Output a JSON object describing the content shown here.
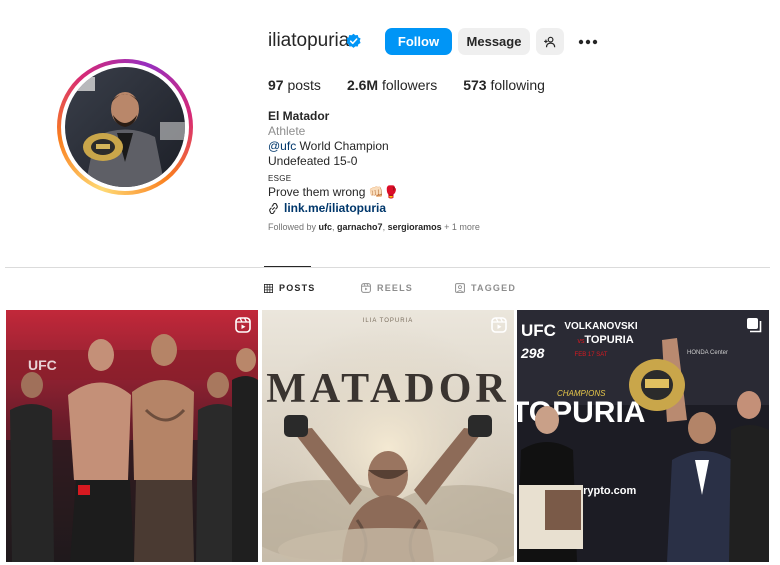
{
  "profile": {
    "username": "iliatopuria",
    "follow_label": "Follow",
    "message_label": "Message"
  },
  "stats": {
    "posts_count": "97",
    "posts_label": "posts",
    "followers_count": "2.6M",
    "followers_label": "followers",
    "following_count": "573",
    "following_label": "following"
  },
  "bio": {
    "name": "El Matador",
    "category": "Athlete",
    "mention": "@ufc",
    "line1_rest": " World Champion",
    "line2": "Undefeated 15-0",
    "small_caps": "ESGE",
    "line3": "Prove them wrong 👊🏻🥊",
    "link": "link.me/iliatopuria"
  },
  "followed_by": {
    "prefix": "Followed by ",
    "user1": "ufc",
    "sep1": ", ",
    "user2": "garnacho7",
    "sep2": ", ",
    "user3": "sergioramos",
    "suffix": " + 1 more"
  },
  "tabs": {
    "posts": "POSTS",
    "reels": "REELS",
    "tagged": "TAGGED"
  },
  "posts": {
    "p1_banner": "UFC",
    "p2_top": "ILIA TOPURIA",
    "p2_title": "MATADOR",
    "p3_banner_line1": "VOLKANOVSKI",
    "p3_banner_vs": "vs",
    "p3_banner_line2": "TOPURIA",
    "p3_date": "FEB 17 SAT",
    "p3_big": "TOPURIA",
    "p3_sub": "CHAMPIONS",
    "p3_ufc": "UFC",
    "p3_num": "298",
    "p3_crypto": "crypto.com",
    "p3_honda": "HONDA Center"
  },
  "colors": {
    "follow_blue": "#0095f6",
    "link_blue": "#00376b",
    "verified_blue": "#0095f6"
  }
}
